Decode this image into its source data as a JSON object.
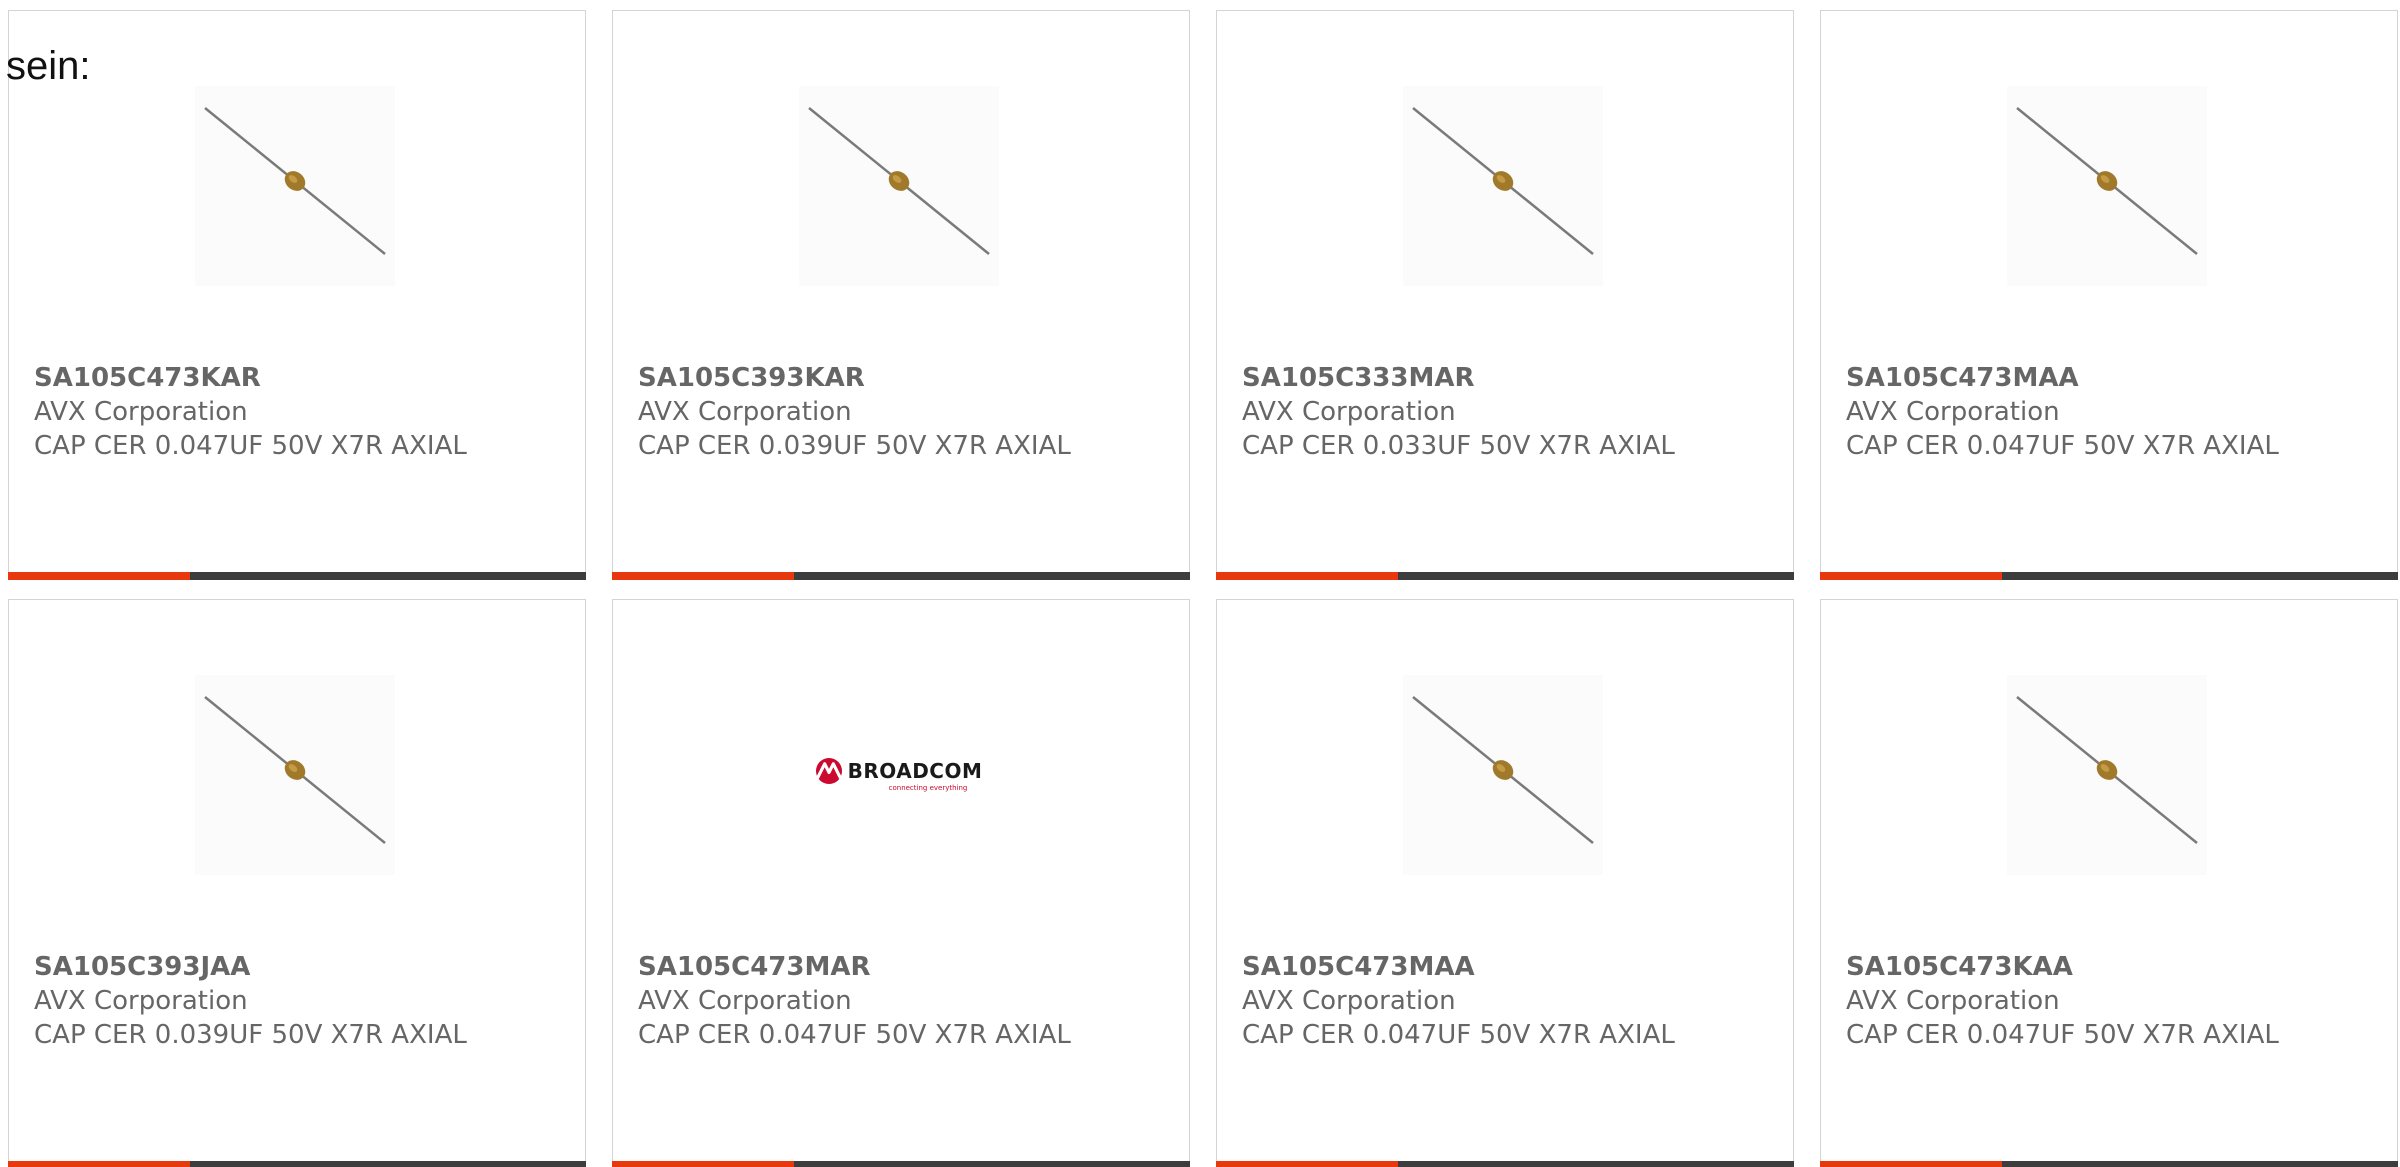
{
  "intro_text": "sein:",
  "colors": {
    "accent": "#e8380d",
    "bar": "#3d3d3d",
    "text": "#666666",
    "border": "#d4d4d4"
  },
  "products": [
    {
      "part_number": "SA105C473KAR",
      "manufacturer": "AVX Corporation",
      "description": "CAP CER 0.047UF 50V X7R AXIAL",
      "image": "axial-capacitor-icon"
    },
    {
      "part_number": "SA105C393KAR",
      "manufacturer": "AVX Corporation",
      "description": "CAP CER 0.039UF 50V X7R AXIAL",
      "image": "axial-capacitor-icon"
    },
    {
      "part_number": "SA105C333MAR",
      "manufacturer": "AVX Corporation",
      "description": "CAP CER 0.033UF 50V X7R AXIAL",
      "image": "axial-capacitor-icon"
    },
    {
      "part_number": "SA105C473MAA",
      "manufacturer": "AVX Corporation",
      "description": "CAP CER 0.047UF 50V X7R AXIAL",
      "image": "axial-capacitor-icon"
    },
    {
      "part_number": "SA105C393JAA",
      "manufacturer": "AVX Corporation",
      "description": "CAP CER 0.039UF 50V X7R AXIAL",
      "image": "axial-capacitor-icon"
    },
    {
      "part_number": "SA105C473MAR",
      "manufacturer": "AVX Corporation",
      "description": "CAP CER 0.047UF 50V X7R AXIAL",
      "image": "broadcom-logo",
      "logo_text": "BROADCOM",
      "logo_tagline": "connecting everything"
    },
    {
      "part_number": "SA105C473MAA",
      "manufacturer": "AVX Corporation",
      "description": "CAP CER 0.047UF 50V X7R AXIAL",
      "image": "axial-capacitor-icon"
    },
    {
      "part_number": "SA105C473KAA",
      "manufacturer": "AVX Corporation",
      "description": "CAP CER 0.047UF 50V X7R AXIAL",
      "image": "axial-capacitor-icon"
    }
  ]
}
